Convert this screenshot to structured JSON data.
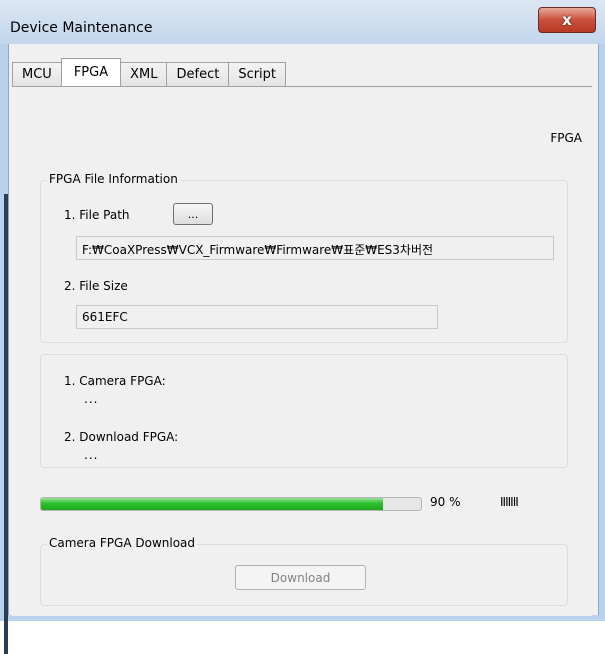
{
  "window": {
    "title": "Device Maintenance",
    "close_glyph": "x"
  },
  "tabs": [
    {
      "label": "MCU",
      "active": false
    },
    {
      "label": "FPGA",
      "active": true
    },
    {
      "label": "XML",
      "active": false
    },
    {
      "label": "Defect",
      "active": false
    },
    {
      "label": "Script",
      "active": false
    }
  ],
  "panel": {
    "heading": "FPGA",
    "file_info": {
      "title": "FPGA File Information",
      "file_path_label": "1. File Path",
      "browse_label": "...",
      "file_path_value": "F:₩CoaXPress₩VCX_Firmware₩Firmware₩표준₩ES3차버전",
      "file_size_label": "2. File Size",
      "file_size_value": "661EFC"
    },
    "versions": {
      "camera_label": "1. Camera FPGA:",
      "camera_value": "...",
      "download_label": "2. Download FPGA:",
      "download_value": "..."
    },
    "progress": {
      "percent": 90,
      "percent_text": "90 %",
      "ticks": "IIIIIII"
    },
    "download_group": {
      "title": "Camera FPGA Download",
      "button_label": "Download",
      "button_enabled": false
    }
  },
  "colors": {
    "progress_fill": "#2bc12b",
    "close_button": "#c8503c",
    "title_bar": "#c3d6ec"
  }
}
